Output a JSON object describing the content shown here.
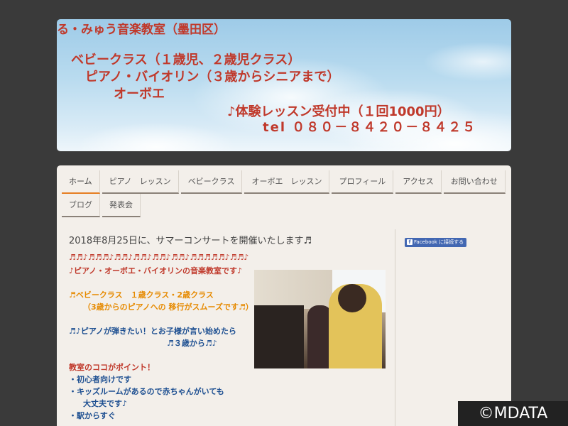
{
  "header": {
    "line1": "る・みゅう音楽教室（墨田区）",
    "line2": "ベビークラス（１歳児、２歳児クラス）",
    "line3": "ピアノ・バイオリン（３歳からシニアまで）",
    "line4": "オーボエ",
    "line5": "♪体験レッスン受付中（１回1000円）",
    "line6": "tel ０８０－８４２０－８４２５"
  },
  "nav": {
    "items": [
      "ホーム",
      "ピアノ　レッスン",
      "ベビークラス",
      "オーボエ　レッスン",
      "プロフィール",
      "アクセス",
      "お問い合わせ",
      "ブログ",
      "発表会"
    ]
  },
  "post": {
    "title": "2018年8月25日に、サマーコンサートを開催いたします♬",
    "notes": "♬♬♪♬♬♬♪♬♬♪♬♬♪♬♬♪♬♬♪♬♬♬♬♬♪♬♬♪",
    "intro": "♪ピアノ・オーボエ・バイオリンの音楽教室です♪",
    "classes1": "♬ベビークラス　１歳クラス・2歳クラス",
    "classes2": "（3歳からのピアノへの 移行がスムーズです♬）",
    "wish1": "♬♪ピアノが弾きたい！とお子様が言い始めたら",
    "wish2": "♬３歳から♬♪",
    "point_title": "教室のココがポイント！",
    "point1": "・初心者向けです",
    "point2": "・キッズルームがあるので赤ちゃんがいても",
    "point2b": "大丈夫です♪",
    "point3": "・駅からすぐ"
  },
  "sidebar": {
    "facebook_label": "Facebook に接続する",
    "facebook_icon_glyph": "f"
  },
  "watermark": "©MDATA",
  "colors": {
    "accent": "#e67e22",
    "header_text": "#c0392b",
    "facebook": "#4267b2"
  }
}
